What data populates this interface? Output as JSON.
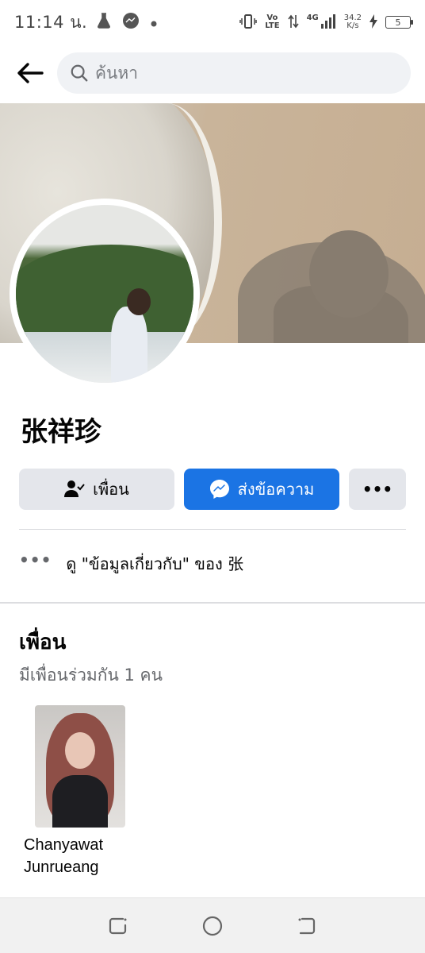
{
  "status_bar": {
    "time": "11:14 น.",
    "net_top": "Vo",
    "net_bottom": "LTE",
    "gen": "4G",
    "speed_top": "34.2",
    "speed_bottom": "K/s",
    "battery": "5"
  },
  "search": {
    "placeholder": "ค้นหา"
  },
  "profile": {
    "name": "张祥珍"
  },
  "actions": {
    "friend_label": "เพื่อน",
    "message_label": "ส่งข้อความ",
    "more_label": "•••"
  },
  "about": {
    "dots": "•••",
    "text": "ดู \"ข้อมูลเกี่ยวกับ\" ของ 张"
  },
  "friends": {
    "title": "เพื่อน",
    "mutual": "มีเพื่อนร่วมกัน 1 คน",
    "list": [
      {
        "name_line1": "Chanyawat",
        "name_line2": "Junrueang"
      }
    ]
  },
  "colors": {
    "accent": "#1b74e4",
    "button_gray": "#e4e6eb",
    "secondary_text": "#65676b"
  }
}
